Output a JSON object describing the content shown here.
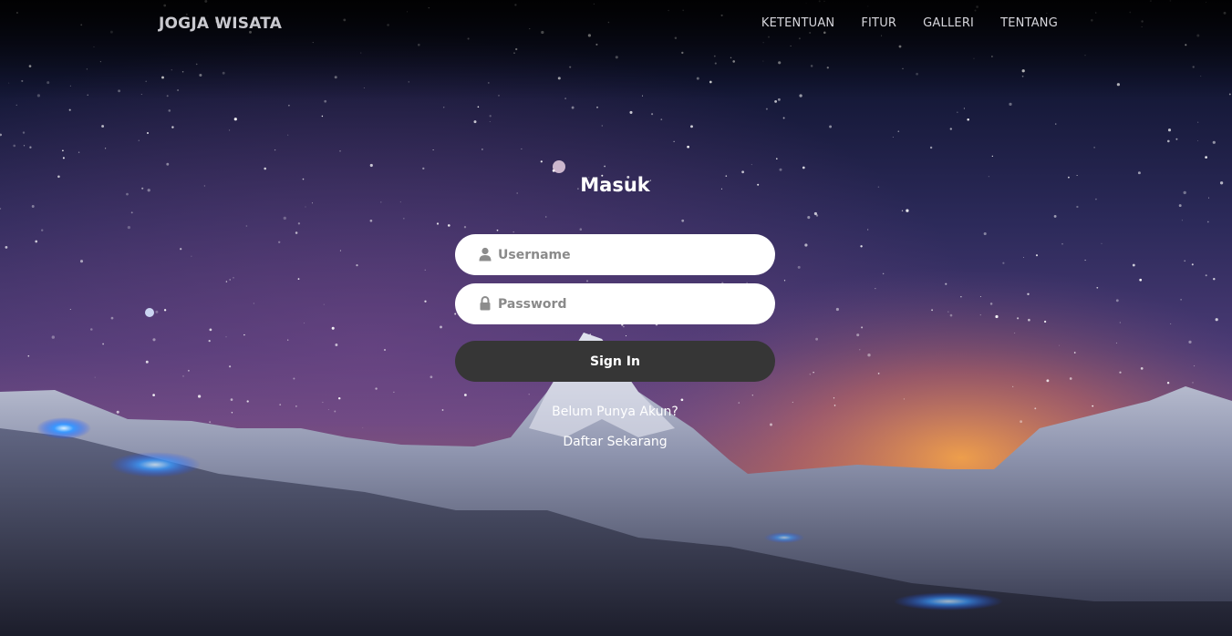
{
  "navbar": {
    "brand": "JOGJA WISATA",
    "links": [
      "KETENTUAN",
      "FITUR",
      "GALLERI",
      "TENTANG"
    ]
  },
  "login": {
    "title": "Masuk",
    "username_placeholder": "Username",
    "password_placeholder": "Password",
    "sign_in_label": "Sign In",
    "register_question": "Belum Punya Akun?",
    "register_link": "Daftar Sekarang"
  },
  "icons": {
    "username": "user-icon",
    "password": "lock-icon"
  },
  "colors": {
    "button_bg": "#363636",
    "input_bg": "#ffffff",
    "text_light": "#ffffff",
    "nav_text": "#d6d6dc"
  }
}
